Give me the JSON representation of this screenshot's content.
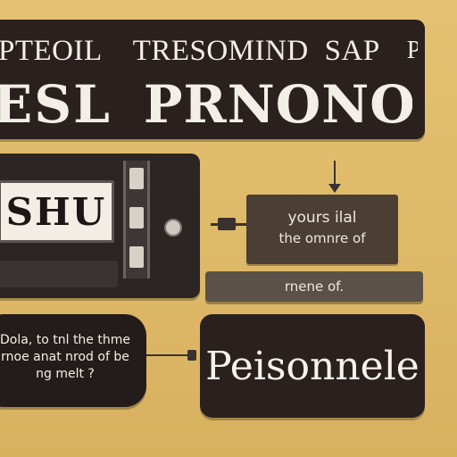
{
  "banner": {
    "row1": [
      "PTEOIL",
      "TRESOMIND",
      "SAP",
      "PONE"
    ],
    "row2": [
      "ESL",
      "PRNONON"
    ]
  },
  "device": {
    "screen_text": "SHU"
  },
  "note": {
    "line1": "yours ilal",
    "line2": "the omnre of"
  },
  "tray": {
    "label": "rnene of."
  },
  "bubble": {
    "text": "Dola, to tnl the thme rnoe anat nrod of be ng melt ?"
  },
  "name_box": {
    "label": "Peisonnele"
  },
  "colors": {
    "background": "#e2bd6c",
    "panel": "#2a211f",
    "note_fill": "#4a3f32",
    "tray_fill": "#5a5149",
    "text_light": "#f4efe6"
  }
}
